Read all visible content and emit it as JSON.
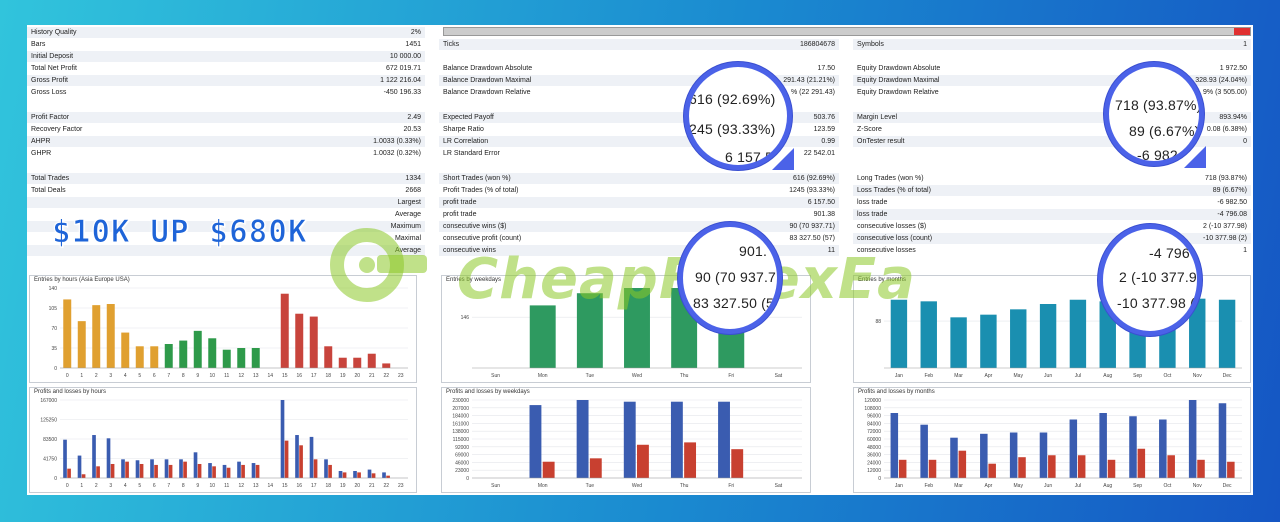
{
  "promo": "$10K UP $680K",
  "watermark": "CheapForexEa",
  "progress_fraction": 0.02,
  "col1": [
    {
      "k": "History Quality",
      "v": "2%"
    },
    {
      "k": "Bars",
      "v": "1451"
    },
    {
      "k": "Initial Deposit",
      "v": "10 000.00"
    },
    {
      "k": "Total Net Profit",
      "v": "672 019.71"
    },
    {
      "k": "Gross Profit",
      "v": "1 122 216.04"
    },
    {
      "k": "Gross Loss",
      "v": "-450 196.33"
    },
    {
      "k": "Profit Factor",
      "v": "2.49"
    },
    {
      "k": "Recovery Factor",
      "v": "20.53"
    },
    {
      "k": "AHPR",
      "v": "1.0033 (0.33%)"
    },
    {
      "k": "GHPR",
      "v": "1.0032 (0.32%)"
    },
    {
      "k": "Total Trades",
      "v": "1334"
    },
    {
      "k": "Total Deals",
      "v": "2668"
    },
    {
      "k": "",
      "v": "Largest"
    },
    {
      "k": "",
      "v": "Average"
    },
    {
      "k": "",
      "v": "Maximum"
    },
    {
      "k": "",
      "v": "Maximal"
    },
    {
      "k": "",
      "v": "Average"
    }
  ],
  "col2": [
    {
      "k": "Ticks",
      "v": "186804678"
    },
    {
      "k": "Balance Drawdown Absolute",
      "v": "17.50"
    },
    {
      "k": "Balance Drawdown Maximal",
      "v": "291.43 (21.21%)"
    },
    {
      "k": "Balance Drawdown Relative",
      "v": "% (22 291.43)"
    },
    {
      "k": "Expected Payoff",
      "v": "503.76"
    },
    {
      "k": "Sharpe Ratio",
      "v": "123.59"
    },
    {
      "k": "LR Correlation",
      "v": "0.99"
    },
    {
      "k": "LR Standard Error",
      "v": "22 542.01"
    },
    {
      "k": "Short Trades (won %)",
      "v": "616 (92.69%)"
    },
    {
      "k": "Profit Trades (% of total)",
      "v": "1245 (93.33%)"
    },
    {
      "k": "profit trade",
      "v": "6 157.50"
    },
    {
      "k": "profit trade",
      "v": "901.38"
    },
    {
      "k": "consecutive wins ($)",
      "v": "90 (70 937.71)"
    },
    {
      "k": "consecutive profit (count)",
      "v": "83 327.50 (57)"
    },
    {
      "k": "consecutive wins",
      "v": "11"
    }
  ],
  "col3": [
    {
      "k": "Symbols",
      "v": "1"
    },
    {
      "k": "Equity Drawdown Absolute",
      "v": "1 972.50"
    },
    {
      "k": "Equity Drawdown Maximal",
      "v": "328.93 (24.04%)"
    },
    {
      "k": "Equity Drawdown Relative",
      "v": "9% (3 505.00)"
    },
    {
      "k": "Margin Level",
      "v": "893.94%"
    },
    {
      "k": "Z-Score",
      "v": "0.08 (6.38%)"
    },
    {
      "k": "OnTester result",
      "v": "0"
    },
    {
      "k": "Long Trades (won %)",
      "v": "718 (93.87%)"
    },
    {
      "k": "Loss Trades (% of total)",
      "v": "89 (6.67%)"
    },
    {
      "k": "loss trade",
      "v": "-6 982.50"
    },
    {
      "k": "loss trade",
      "v": "-4 796.08"
    },
    {
      "k": "consecutive losses ($)",
      "v": "2 (-10 377.98)"
    },
    {
      "k": "consecutive loss (count)",
      "v": "-10 377.98 (2)"
    },
    {
      "k": "consecutive losses",
      "v": "1"
    }
  ],
  "magnifiers": {
    "m1": [
      "616 (92.69%)",
      "245 (93.33%)",
      "6 157.5"
    ],
    "m2": [
      "718 (93.87%)",
      "89 (6.67%)",
      "-6 982.5"
    ],
    "m3": [
      "901.",
      "90 (70 937.71",
      "83 327.50 (57"
    ],
    "m4": [
      "-4 796",
      "2 (-10 377.9",
      "-10 377.98 ("
    ]
  },
  "chart_data": [
    {
      "type": "bar",
      "title": "Entries by hours (Asia Europe USA)",
      "categories": [
        "0",
        "1",
        "2",
        "3",
        "4",
        "5",
        "6",
        "7",
        "8",
        "9",
        "10",
        "11",
        "12",
        "13",
        "14",
        "15",
        "16",
        "17",
        "18",
        "19",
        "20",
        "21",
        "22",
        "23"
      ],
      "yticks": [
        "140",
        "105",
        "70",
        "35",
        "0"
      ],
      "ylim": [
        0,
        140
      ],
      "values": [
        120,
        82,
        110,
        112,
        62,
        38,
        38,
        42,
        48,
        65,
        52,
        32,
        35,
        35,
        0,
        130,
        95,
        90,
        38,
        18,
        18,
        25,
        8,
        0
      ],
      "colors": [
        "#e0a030",
        "#e0a030",
        "#e0a030",
        "#e0a030",
        "#e0a030",
        "#e0a030",
        "#e0a030",
        "#2e9a4a",
        "#2e9a4a",
        "#2e9a4a",
        "#2e9a4a",
        "#2e9a4a",
        "#2e9a4a",
        "#2e9a4a",
        "#2e9a4a",
        "#c8443c",
        "#c8443c",
        "#c8443c",
        "#c8443c",
        "#c8443c",
        "#c8443c",
        "#c8443c",
        "#c8443c",
        "#c8443c"
      ]
    },
    {
      "type": "bar",
      "title": "Entries by weekdays",
      "categories": [
        "Sun",
        "Mon",
        "Tue",
        "Wed",
        "Thu",
        "Fri",
        "Sat"
      ],
      "yticks": [
        "146"
      ],
      "ylim": [
        0,
        230
      ],
      "values": [
        0,
        180,
        215,
        230,
        230,
        195,
        0
      ],
      "colors": [
        "#2e9a60",
        "#2e9a60",
        "#2e9a60",
        "#2e9a60",
        "#2e9a60",
        "#2e9a60",
        "#2e9a60"
      ]
    },
    {
      "type": "bar",
      "title": "Entries by months",
      "categories": [
        "Jan",
        "Feb",
        "Mar",
        "Apr",
        "May",
        "Jun",
        "Jul",
        "Aug",
        "Sep",
        "Oct",
        "Nov",
        "Dec"
      ],
      "yticks": [
        "88"
      ],
      "ylim": [
        0,
        150
      ],
      "values": [
        128,
        125,
        95,
        100,
        110,
        120,
        128,
        125,
        130,
        120,
        130,
        128
      ],
      "colors": [
        "#1a8fb0",
        "#1a8fb0",
        "#1a8fb0",
        "#1a8fb0",
        "#1a8fb0",
        "#1a8fb0",
        "#1a8fb0",
        "#1a8fb0",
        "#1a8fb0",
        "#1a8fb0",
        "#1a8fb0",
        "#1a8fb0"
      ]
    },
    {
      "type": "bar",
      "title": "Profits and losses by hours",
      "categories": [
        "0",
        "1",
        "2",
        "3",
        "4",
        "5",
        "6",
        "7",
        "8",
        "9",
        "10",
        "11",
        "12",
        "13",
        "14",
        "15",
        "16",
        "17",
        "18",
        "19",
        "20",
        "21",
        "22",
        "23"
      ],
      "yticks": [
        "167000",
        "125250",
        "83500",
        "41750",
        "0"
      ],
      "ylim": [
        0,
        167000
      ],
      "series": [
        {
          "values": [
            82000,
            48000,
            92000,
            85000,
            40000,
            38000,
            40000,
            40000,
            40000,
            55000,
            32000,
            28000,
            35000,
            32000,
            0,
            167000,
            92000,
            88000,
            40000,
            15000,
            15000,
            18000,
            12000,
            0
          ],
          "color": "#3a5cb0"
        },
        {
          "values": [
            20000,
            8000,
            25000,
            30000,
            35000,
            30000,
            28000,
            28000,
            35000,
            30000,
            25000,
            22000,
            28000,
            28000,
            0,
            80000,
            70000,
            40000,
            28000,
            12000,
            12000,
            10000,
            5000,
            0
          ],
          "color": "#c84030"
        }
      ]
    },
    {
      "type": "bar",
      "title": "Profits and losses by weekdays",
      "categories": [
        "Sun",
        "Mon",
        "Tue",
        "Wed",
        "Thu",
        "Fri",
        "Sat"
      ],
      "yticks": [
        "230000",
        "207000",
        "184000",
        "161000",
        "138000",
        "115000",
        "92000",
        "69000",
        "46000",
        "23000",
        "0"
      ],
      "ylim": [
        0,
        230000
      ],
      "series": [
        {
          "values": [
            0,
            215000,
            230000,
            225000,
            225000,
            225000,
            0
          ],
          "color": "#3a5cb0"
        },
        {
          "values": [
            0,
            48000,
            58000,
            98000,
            105000,
            85000,
            0
          ],
          "color": "#c84030"
        }
      ]
    },
    {
      "type": "bar",
      "title": "Profits and losses by months",
      "categories": [
        "Jan",
        "Feb",
        "Mar",
        "Apr",
        "May",
        "Jun",
        "Jul",
        "Aug",
        "Sep",
        "Oct",
        "Nov",
        "Dec"
      ],
      "yticks": [
        "120000",
        "108000",
        "96000",
        "84000",
        "72000",
        "60000",
        "48000",
        "36000",
        "24000",
        "12000",
        "0"
      ],
      "ylim": [
        0,
        120000
      ],
      "series": [
        {
          "values": [
            100000,
            82000,
            62000,
            68000,
            70000,
            70000,
            90000,
            100000,
            95000,
            90000,
            120000,
            115000
          ],
          "color": "#3a5cb0"
        },
        {
          "values": [
            28000,
            28000,
            42000,
            22000,
            32000,
            35000,
            35000,
            28000,
            45000,
            35000,
            28000,
            25000
          ],
          "color": "#c84030"
        }
      ]
    }
  ]
}
